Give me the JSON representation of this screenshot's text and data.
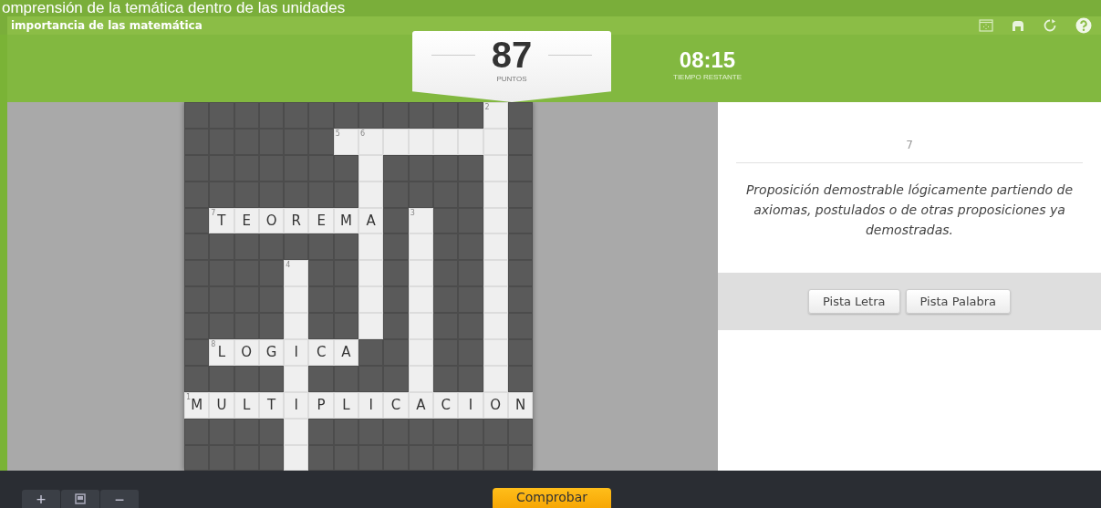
{
  "header": {
    "subtitle": "omprensión de la temática dentro de las unidades",
    "title": "importancia de las matemática"
  },
  "score": {
    "value": "87",
    "label": "PUNTOS"
  },
  "timer": {
    "value": "08:15",
    "label": "TIEMPO RESTANTE"
  },
  "crossword": {
    "rows": [
      [
        {
          "kind": "block"
        },
        {
          "kind": "block"
        },
        {
          "kind": "block"
        },
        {
          "kind": "block"
        },
        {
          "kind": "block"
        },
        {
          "kind": "block"
        },
        {
          "kind": "block"
        },
        {
          "kind": "block"
        },
        {
          "kind": "block"
        },
        {
          "kind": "block"
        },
        {
          "kind": "block"
        },
        {
          "kind": "block"
        },
        {
          "kind": "open",
          "number": "2"
        },
        {
          "kind": "block"
        }
      ],
      [
        {
          "kind": "block"
        },
        {
          "kind": "block"
        },
        {
          "kind": "block"
        },
        {
          "kind": "block"
        },
        {
          "kind": "block"
        },
        {
          "kind": "block"
        },
        {
          "kind": "open",
          "number": "5"
        },
        {
          "kind": "open",
          "number": "6"
        },
        {
          "kind": "open"
        },
        {
          "kind": "open"
        },
        {
          "kind": "open"
        },
        {
          "kind": "open"
        },
        {
          "kind": "open"
        },
        {
          "kind": "block"
        }
      ],
      [
        {
          "kind": "block"
        },
        {
          "kind": "block"
        },
        {
          "kind": "block"
        },
        {
          "kind": "block"
        },
        {
          "kind": "block"
        },
        {
          "kind": "block"
        },
        {
          "kind": "block"
        },
        {
          "kind": "open"
        },
        {
          "kind": "block"
        },
        {
          "kind": "block"
        },
        {
          "kind": "block"
        },
        {
          "kind": "block"
        },
        {
          "kind": "open"
        },
        {
          "kind": "block"
        }
      ],
      [
        {
          "kind": "block"
        },
        {
          "kind": "block"
        },
        {
          "kind": "block"
        },
        {
          "kind": "block"
        },
        {
          "kind": "block"
        },
        {
          "kind": "block"
        },
        {
          "kind": "block"
        },
        {
          "kind": "open"
        },
        {
          "kind": "block"
        },
        {
          "kind": "block"
        },
        {
          "kind": "block"
        },
        {
          "kind": "block"
        },
        {
          "kind": "open"
        },
        {
          "kind": "block"
        }
      ],
      [
        {
          "kind": "block"
        },
        {
          "kind": "open",
          "number": "7",
          "letter": "T"
        },
        {
          "kind": "open",
          "letter": "E"
        },
        {
          "kind": "open",
          "letter": "O"
        },
        {
          "kind": "open",
          "letter": "R"
        },
        {
          "kind": "open",
          "letter": "E"
        },
        {
          "kind": "open",
          "letter": "M"
        },
        {
          "kind": "open",
          "letter": "A"
        },
        {
          "kind": "block"
        },
        {
          "kind": "open",
          "number": "3"
        },
        {
          "kind": "block"
        },
        {
          "kind": "block"
        },
        {
          "kind": "open"
        },
        {
          "kind": "block"
        }
      ],
      [
        {
          "kind": "block"
        },
        {
          "kind": "block"
        },
        {
          "kind": "block"
        },
        {
          "kind": "block"
        },
        {
          "kind": "block"
        },
        {
          "kind": "block"
        },
        {
          "kind": "block"
        },
        {
          "kind": "open"
        },
        {
          "kind": "block"
        },
        {
          "kind": "open"
        },
        {
          "kind": "block"
        },
        {
          "kind": "block"
        },
        {
          "kind": "open"
        },
        {
          "kind": "block"
        }
      ],
      [
        {
          "kind": "block"
        },
        {
          "kind": "block"
        },
        {
          "kind": "block"
        },
        {
          "kind": "block"
        },
        {
          "kind": "open",
          "number": "4"
        },
        {
          "kind": "block"
        },
        {
          "kind": "block"
        },
        {
          "kind": "open"
        },
        {
          "kind": "block"
        },
        {
          "kind": "open"
        },
        {
          "kind": "block"
        },
        {
          "kind": "block"
        },
        {
          "kind": "open"
        },
        {
          "kind": "block"
        }
      ],
      [
        {
          "kind": "block"
        },
        {
          "kind": "block"
        },
        {
          "kind": "block"
        },
        {
          "kind": "block"
        },
        {
          "kind": "open"
        },
        {
          "kind": "block"
        },
        {
          "kind": "block"
        },
        {
          "kind": "open"
        },
        {
          "kind": "block"
        },
        {
          "kind": "open"
        },
        {
          "kind": "block"
        },
        {
          "kind": "block"
        },
        {
          "kind": "open"
        },
        {
          "kind": "block"
        }
      ],
      [
        {
          "kind": "block"
        },
        {
          "kind": "block"
        },
        {
          "kind": "block"
        },
        {
          "kind": "block"
        },
        {
          "kind": "open"
        },
        {
          "kind": "block"
        },
        {
          "kind": "block"
        },
        {
          "kind": "open"
        },
        {
          "kind": "block"
        },
        {
          "kind": "open"
        },
        {
          "kind": "block"
        },
        {
          "kind": "block"
        },
        {
          "kind": "open"
        },
        {
          "kind": "block"
        }
      ],
      [
        {
          "kind": "block"
        },
        {
          "kind": "open",
          "number": "8",
          "letter": "L"
        },
        {
          "kind": "open",
          "letter": "O"
        },
        {
          "kind": "open",
          "letter": "G"
        },
        {
          "kind": "open",
          "letter": "I"
        },
        {
          "kind": "open",
          "letter": "C"
        },
        {
          "kind": "open",
          "letter": "A"
        },
        {
          "kind": "block"
        },
        {
          "kind": "block"
        },
        {
          "kind": "open"
        },
        {
          "kind": "block"
        },
        {
          "kind": "block"
        },
        {
          "kind": "open"
        },
        {
          "kind": "block"
        }
      ],
      [
        {
          "kind": "block"
        },
        {
          "kind": "block"
        },
        {
          "kind": "block"
        },
        {
          "kind": "block"
        },
        {
          "kind": "open"
        },
        {
          "kind": "block"
        },
        {
          "kind": "block"
        },
        {
          "kind": "block"
        },
        {
          "kind": "block"
        },
        {
          "kind": "open"
        },
        {
          "kind": "block"
        },
        {
          "kind": "block"
        },
        {
          "kind": "open"
        },
        {
          "kind": "block"
        }
      ],
      [
        {
          "kind": "open",
          "number": "1",
          "letter": "M"
        },
        {
          "kind": "open",
          "letter": "U"
        },
        {
          "kind": "open",
          "letter": "L"
        },
        {
          "kind": "open",
          "letter": "T"
        },
        {
          "kind": "open",
          "letter": "I"
        },
        {
          "kind": "open",
          "letter": "P"
        },
        {
          "kind": "open",
          "letter": "L"
        },
        {
          "kind": "open",
          "letter": "I"
        },
        {
          "kind": "open",
          "letter": "C"
        },
        {
          "kind": "open",
          "letter": "A"
        },
        {
          "kind": "open",
          "letter": "C"
        },
        {
          "kind": "open",
          "letter": "I"
        },
        {
          "kind": "open",
          "letter": "O"
        },
        {
          "kind": "open",
          "letter": "N"
        }
      ],
      [
        {
          "kind": "block"
        },
        {
          "kind": "block"
        },
        {
          "kind": "block"
        },
        {
          "kind": "block"
        },
        {
          "kind": "open"
        },
        {
          "kind": "block"
        },
        {
          "kind": "block"
        },
        {
          "kind": "block"
        },
        {
          "kind": "block"
        },
        {
          "kind": "block"
        },
        {
          "kind": "block"
        },
        {
          "kind": "block"
        },
        {
          "kind": "block"
        },
        {
          "kind": "block"
        }
      ],
      [
        {
          "kind": "block"
        },
        {
          "kind": "block"
        },
        {
          "kind": "block"
        },
        {
          "kind": "block"
        },
        {
          "kind": "open"
        },
        {
          "kind": "block"
        },
        {
          "kind": "block"
        },
        {
          "kind": "block"
        },
        {
          "kind": "block"
        },
        {
          "kind": "block"
        },
        {
          "kind": "block"
        },
        {
          "kind": "block"
        },
        {
          "kind": "block"
        },
        {
          "kind": "block"
        }
      ]
    ]
  },
  "clue": {
    "number": "7",
    "text": "Proposición demostrable lógicamente partiendo de axiomas, postulados o de otras proposiciones ya demostradas."
  },
  "hint_buttons": [
    "Pista Letra",
    "Pista Palabra"
  ],
  "zoom_controls": [
    "+",
    "−"
  ],
  "check_button": "Comprobar"
}
